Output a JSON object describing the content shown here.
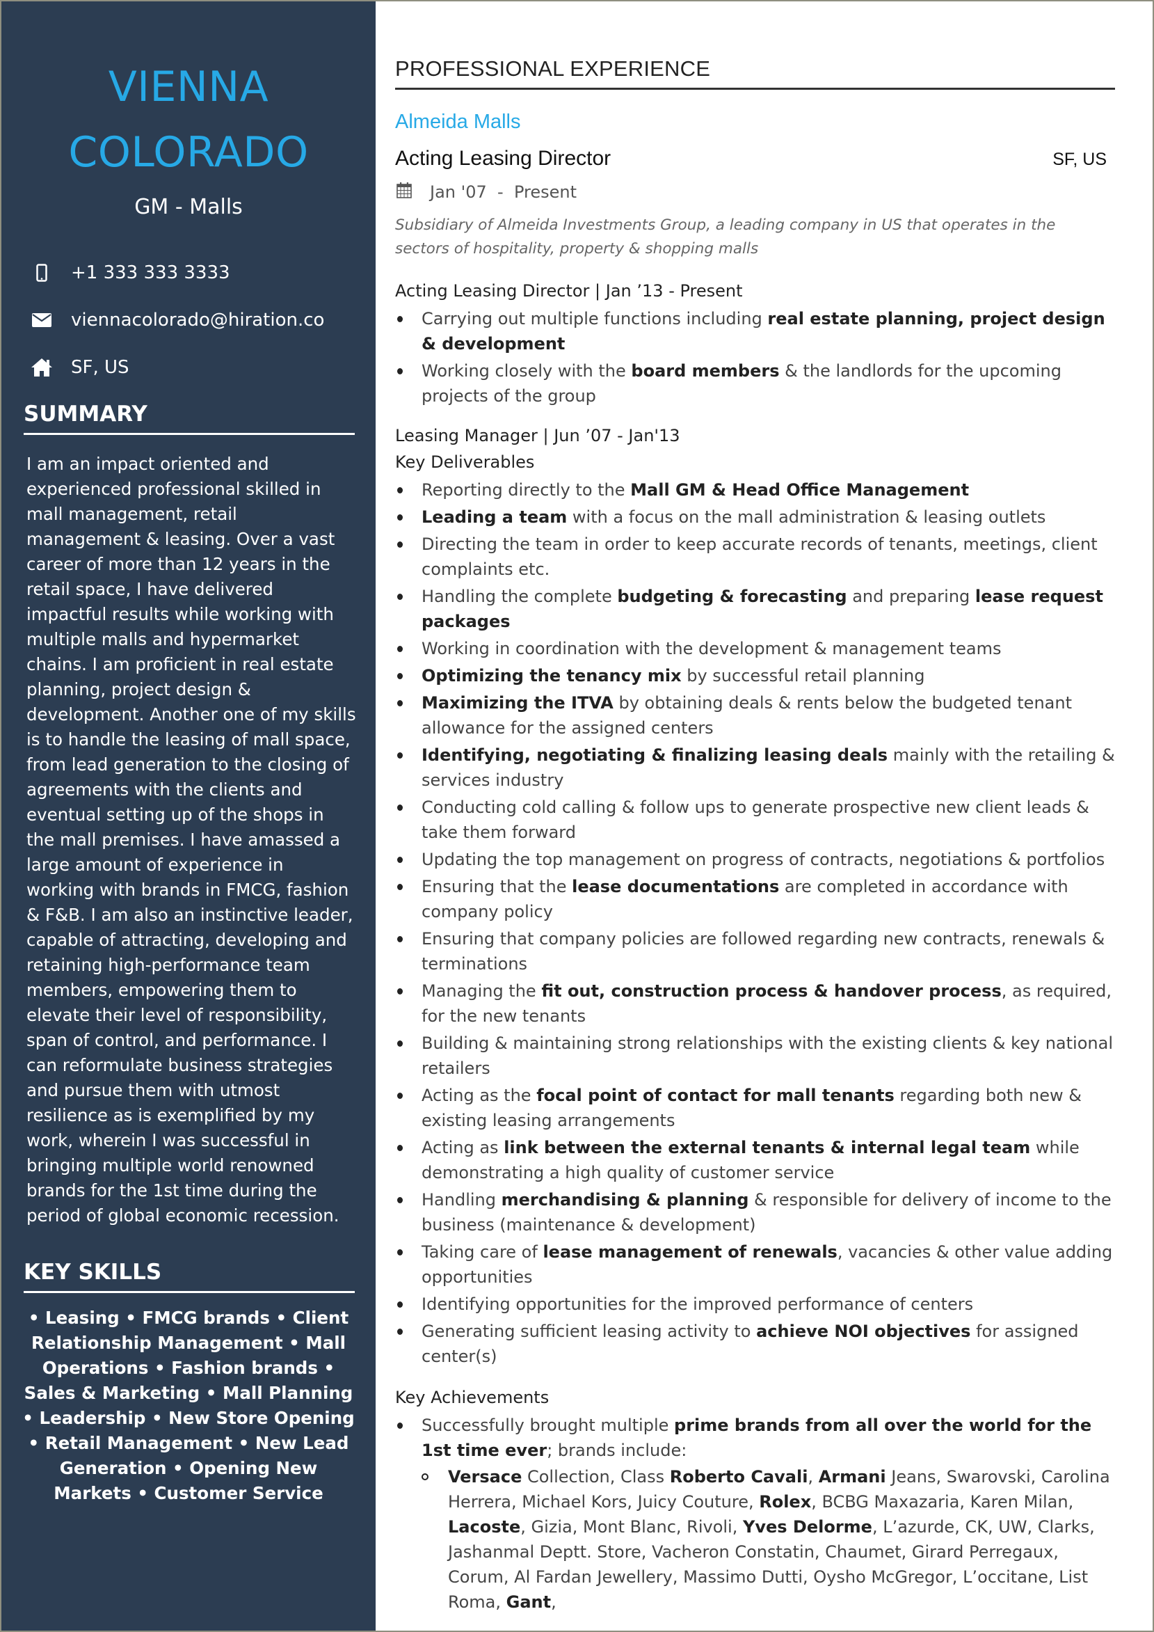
{
  "sidebar": {
    "name_line1": "VIENNA",
    "name_line2": "COLORADO",
    "headline": "GM - Malls",
    "contacts": [
      {
        "icon": "mobile-phone-icon",
        "text": "+1 333 333 3333"
      },
      {
        "icon": "envelope-icon",
        "text": "viennacolorado@hiration.co"
      },
      {
        "icon": "home-icon",
        "text": "SF, US"
      }
    ],
    "summary_heading": "SUMMARY",
    "summary_text": "I am an impact oriented and experienced professional skilled in mall management, retail management & leasing. Over a vast career of more than 12 years in the retail space, I have delivered impactful results while working with multiple malls and hypermarket chains. I am proficient in real estate planning, project design & development. Another one of my skills is to handle the leasing of mall space, from lead generation to the closing of agreements with the clients and eventual setting up of the shops in the mall premises. I have amassed a large amount of experience in working with brands in FMCG, fashion & F&B. I am also an instinctive leader, capable of attracting, developing and retaining high-performance team members, empowering them to elevate their level of responsibility, span of control, and performance. I can reformulate business strategies and pursue them with utmost resilience as is exemplified by my work, wherein I was successful in bringing multiple world renowned brands for the 1st time during the period of global economic recession.",
    "skills_heading": "KEY SKILLS",
    "skills": [
      "Leasing",
      "FMCG brands",
      "Client Relationship Management",
      "Mall Operations",
      "Fashion brands",
      "Sales & Marketing",
      "Mall Planning",
      "Leadership",
      "New Store Opening",
      "Retail Management",
      "New Lead Generation",
      "Opening New Markets",
      "Customer Service"
    ]
  },
  "main": {
    "section_heading": "PROFESSIONAL EXPERIENCE",
    "company": "Almeida Malls",
    "role": "Acting Leasing Director",
    "location": "SF, US",
    "date_icon": "calendar-icon",
    "dates": "Jan '07  -  Present",
    "description": "Subsidiary of Almeida Investments Group, a leading company in US that operates in the sectors of hospitality, property & shopping malls",
    "positions": [
      {
        "title": "Acting Leasing Director | Jan ’13 - Present",
        "bullets": [
          [
            [
              "",
              "Carrying out multiple functions including "
            ],
            [
              "b",
              "real estate planning, project design & development"
            ]
          ],
          [
            [
              "",
              "Working closely with the "
            ],
            [
              "b",
              "board members"
            ],
            [
              "",
              " & the landlords for the upcoming projects of the group"
            ]
          ]
        ]
      },
      {
        "title": "Leasing Manager | Jun ’07 - Jan'13",
        "subtitle": "Key Deliverables",
        "bullets": [
          [
            [
              "",
              "Reporting directly to the "
            ],
            [
              "b",
              "Mall GM & Head Office Management"
            ]
          ],
          [
            [
              "b",
              "Leading a team"
            ],
            [
              "",
              " with a focus on the mall administration & leasing outlets"
            ]
          ],
          [
            [
              "",
              "Directing the team in order to keep accurate records of tenants, meetings, client complaints etc."
            ]
          ],
          [
            [
              "",
              "Handling the complete "
            ],
            [
              "b",
              "budgeting & forecasting"
            ],
            [
              "",
              " and preparing "
            ],
            [
              "b",
              "lease request packages"
            ]
          ],
          [
            [
              "",
              "Working in coordination with the development & management teams"
            ]
          ],
          [
            [
              "b",
              "Optimizing the tenancy mix"
            ],
            [
              "",
              " by successful retail planning"
            ]
          ],
          [
            [
              "b",
              "Maximizing the ITVA"
            ],
            [
              "",
              " by obtaining deals & rents below the budgeted tenant allowance for the assigned centers"
            ]
          ],
          [
            [
              "b",
              "Identifying, negotiating & finalizing leasing deals"
            ],
            [
              "",
              " mainly with the retailing & services industry"
            ]
          ],
          [
            [
              "",
              "Conducting cold calling & follow ups to generate prospective new client leads & take them forward"
            ]
          ],
          [
            [
              "",
              "Updating the top management on progress of contracts, negotiations & portfolios"
            ]
          ],
          [
            [
              "",
              "Ensuring that the "
            ],
            [
              "b",
              "lease documentations"
            ],
            [
              "",
              " are completed in accordance with company policy"
            ]
          ],
          [
            [
              "",
              "Ensuring that company policies are followed regarding new contracts, renewals & terminations"
            ]
          ],
          [
            [
              "",
              "Managing the "
            ],
            [
              "b",
              "fit out, construction process & handover process"
            ],
            [
              "",
              ", as required, for the new tenants"
            ]
          ],
          [
            [
              "",
              "Building & maintaining strong relationships with the existing clients & key national retailers"
            ]
          ],
          [
            [
              "",
              "Acting as the "
            ],
            [
              "b",
              "focal point of contact for mall tenants"
            ],
            [
              "",
              " regarding both new & existing leasing arrangements"
            ]
          ],
          [
            [
              "",
              "Acting as "
            ],
            [
              "b",
              "link between the external tenants & internal legal team"
            ],
            [
              "",
              " while demonstrating a high quality of customer service"
            ]
          ],
          [
            [
              "",
              "Handling "
            ],
            [
              "b",
              "merchandising & planning"
            ],
            [
              "",
              " & responsible for delivery of income to the business (maintenance & development)"
            ]
          ],
          [
            [
              "",
              "Taking care of "
            ],
            [
              "b",
              "lease management of renewals"
            ],
            [
              "",
              ", vacancies & other value adding opportunities"
            ]
          ],
          [
            [
              "",
              "Identifying opportunities for the improved performance of centers"
            ]
          ],
          [
            [
              "",
              "Generating sufficient leasing activity to "
            ],
            [
              "b",
              "achieve NOI objectives"
            ],
            [
              "",
              " for assigned center(s)"
            ]
          ]
        ]
      }
    ],
    "achievements_heading": "Key Achievements",
    "achievements": [
      {
        "text": [
          [
            "",
            "Successfully brought multiple "
          ],
          [
            "b",
            "prime brands from all over the world for the 1st time ever"
          ],
          [
            "",
            "; brands include:"
          ]
        ],
        "sub": [
          [
            [
              "b",
              "Versace"
            ],
            [
              "",
              " Collection, Class "
            ],
            [
              "b",
              "Roberto Cavali"
            ],
            [
              "",
              ", "
            ],
            [
              "b",
              "Armani"
            ],
            [
              "",
              " Jeans, Swarovski, Carolina Herrera, Michael Kors, Juicy Couture, "
            ],
            [
              "b",
              "Rolex"
            ],
            [
              "",
              ", BCBG Maxazaria, Karen Milan, "
            ],
            [
              "b",
              "Lacoste"
            ],
            [
              "",
              ", Gizia, Mont Blanc, Rivoli, "
            ],
            [
              "b",
              "Yves Delorme"
            ],
            [
              "",
              ", L’azurde, CK, UW, Clarks, Jashanmal Deptt. Store, Vacheron Constatin, Chaumet, Girard Perregaux, Corum, Al Fardan Jewellery, Massimo Dutti, Oysho McGregor, L’occitane, List Roma, "
            ],
            [
              "b",
              "Gant"
            ],
            [
              "",
              ","
            ]
          ]
        ]
      }
    ]
  },
  "colors": {
    "sidebar_bg": "#2c3d52",
    "accent": "#27a9e6",
    "text_dark": "#333333"
  }
}
